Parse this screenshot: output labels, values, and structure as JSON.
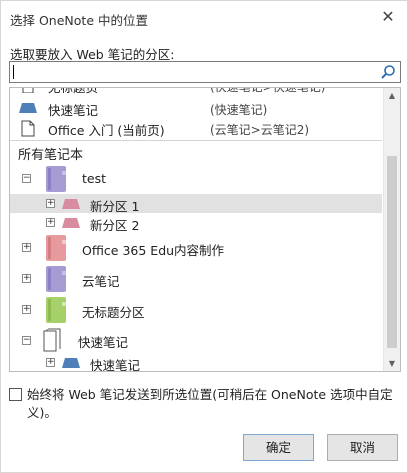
{
  "window": {
    "title": "选择 OneNote 中的位置",
    "close_label": "✕"
  },
  "prompt": "选取要放入 Web 笔记的分区:",
  "search": {
    "value": ""
  },
  "recent": [
    {
      "label": "无标题页",
      "path": "(快速笔记>快速笔记)"
    },
    {
      "label": "快速笔记",
      "path": "(快速笔记)"
    },
    {
      "label": "Office 入门 (当前页)",
      "path": "(云笔记>云笔记2)"
    }
  ],
  "all_notebooks_header": "所有笔记本",
  "tree": {
    "test": {
      "label": "test",
      "sections": [
        "新分区 1",
        "新分区 2"
      ]
    },
    "office365": {
      "label": "Office 365 Edu内容制作"
    },
    "cloud": {
      "label": "云笔记"
    },
    "untitled": {
      "label": "无标题分区"
    },
    "quick": {
      "label": "快速笔记",
      "sections": [
        "快速笔记"
      ]
    }
  },
  "colors": {
    "purple": "#a79bd3",
    "pink": "#e79a9d",
    "green": "#a6d16a",
    "blue_section": "#4f7fb8",
    "pink_section": "#d98ba0",
    "selection": "#e1e1e1"
  },
  "footer": {
    "checkbox_label": "始终将 Web 笔记发送到所选位置(可稍后在 OneNote 选项中自定义)。",
    "ok_label": "确定",
    "cancel_label": "取消"
  }
}
